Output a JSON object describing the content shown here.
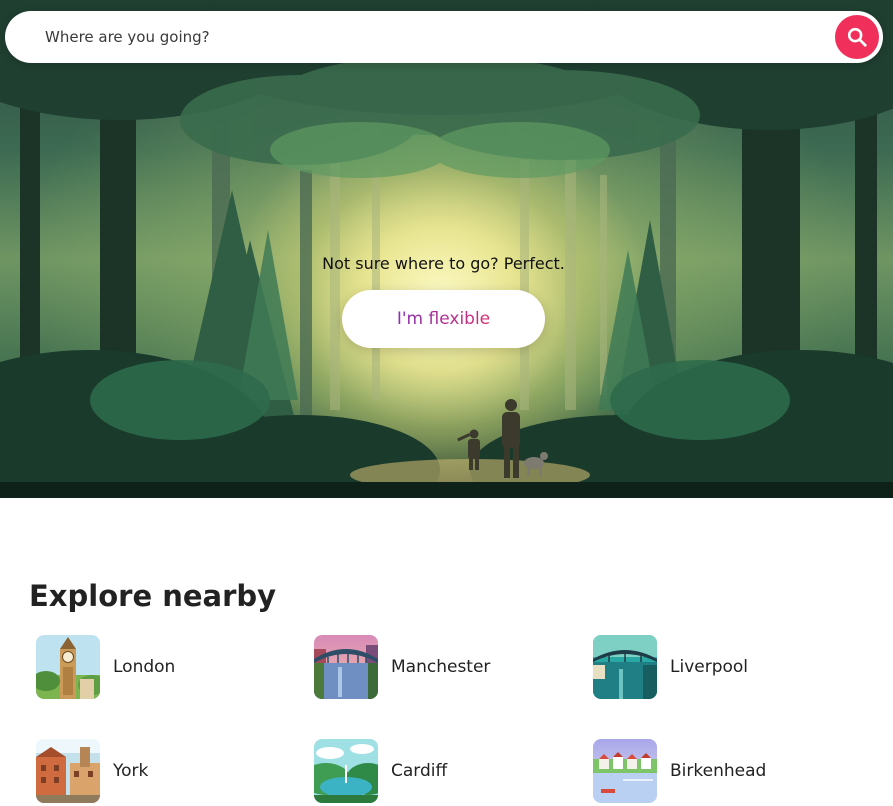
{
  "search": {
    "placeholder": "Where are you going?",
    "button_icon": "search-icon",
    "accent_color": "#f0305a"
  },
  "hero": {
    "headline": "Not sure where to go? Perfect.",
    "flexible_button_label": "I'm flexible",
    "button_gradient": [
      "#8a2fb5",
      "#d62d72"
    ]
  },
  "explore": {
    "title": "Explore nearby",
    "places": [
      {
        "name": "London",
        "thumbnail": "big-ben-illustration"
      },
      {
        "name": "Manchester",
        "thumbnail": "bridge-river-illustration"
      },
      {
        "name": "Liverpool",
        "thumbnail": "bridge-teal-illustration"
      },
      {
        "name": "York",
        "thumbnail": "old-buildings-illustration"
      },
      {
        "name": "Cardiff",
        "thumbnail": "lake-hills-illustration"
      },
      {
        "name": "Birkenhead",
        "thumbnail": "waterfront-houses-illustration"
      }
    ]
  }
}
